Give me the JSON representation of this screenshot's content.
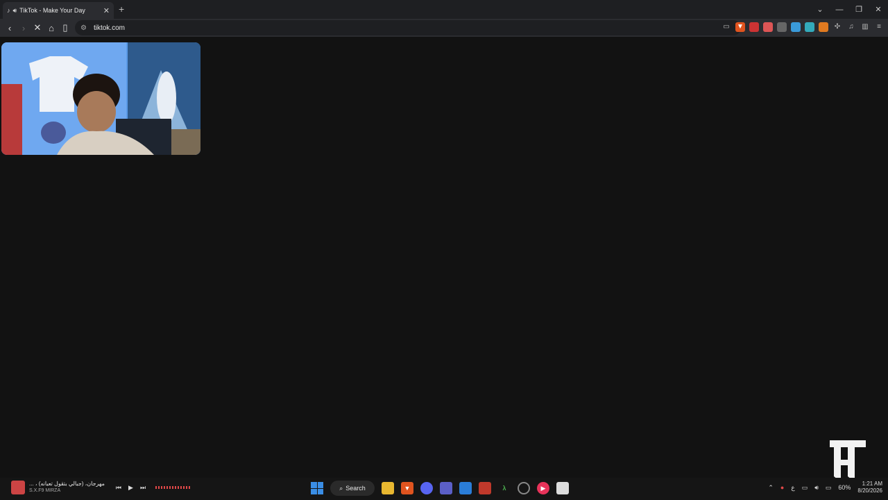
{
  "browser": {
    "tab": {
      "title": "TikTok - Make Your Day",
      "audio_icon": "speaker-icon"
    },
    "new_tab": "+",
    "url": "tiktok.com",
    "window_controls": [
      "⌄",
      "—",
      "❐",
      "✕"
    ]
  },
  "taskbar": {
    "media": {
      "track": "مهرجان، (جبالي بتقول تعبانه) ، ...",
      "artist": "S.X.F9 MIRZA"
    },
    "search_label": "Search",
    "battery": "60%",
    "time": "1:21 AM",
    "date": "8/20/2026",
    "lang": "ع"
  }
}
